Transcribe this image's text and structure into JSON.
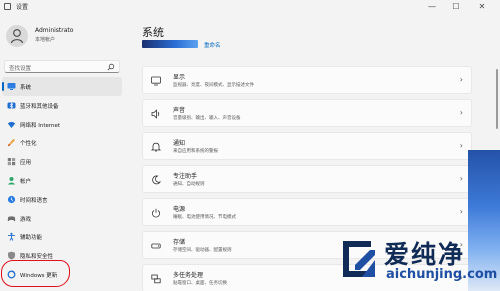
{
  "window": {
    "title": "设置",
    "minimize": "—",
    "maximize": "☐",
    "close": "✕"
  },
  "profile": {
    "name": "Administrato",
    "account_type": "本地帐户"
  },
  "search": {
    "placeholder": "查找设置"
  },
  "nav": {
    "items": [
      {
        "label": "系统",
        "icon": "monitor-icon"
      },
      {
        "label": "蓝牙和其他设备",
        "icon": "bluetooth-icon"
      },
      {
        "label": "网络和 Internet",
        "icon": "wifi-icon"
      },
      {
        "label": "个性化",
        "icon": "brush-icon"
      },
      {
        "label": "应用",
        "icon": "apps-icon"
      },
      {
        "label": "帐户",
        "icon": "person-icon"
      },
      {
        "label": "时间和语言",
        "icon": "globe-clock-icon"
      },
      {
        "label": "游戏",
        "icon": "gamepad-icon"
      },
      {
        "label": "辅助功能",
        "icon": "accessibility-icon"
      },
      {
        "label": "隐私和安全性",
        "icon": "shield-icon"
      },
      {
        "label": "Windows 更新",
        "icon": "windows-update-icon"
      }
    ],
    "active_index": 0
  },
  "main": {
    "title": "系统",
    "hero_link": "重命名",
    "cards": [
      {
        "title": "显示",
        "subtitle": "监视器、亮度、夜间模式、显示描述文件",
        "icon": "display-icon"
      },
      {
        "title": "声音",
        "subtitle": "音量级别、输出、输入、声音设备",
        "icon": "speaker-icon"
      },
      {
        "title": "通知",
        "subtitle": "来自应用和系统的警报",
        "icon": "bell-icon"
      },
      {
        "title": "专注助手",
        "subtitle": "通知、自动规则",
        "icon": "moon-icon"
      },
      {
        "title": "电源",
        "subtitle": "睡眠、电池使用情况、节电模式",
        "icon": "power-icon"
      },
      {
        "title": "存储",
        "subtitle": "存储空间、驱动器、配置规则",
        "icon": "storage-icon"
      },
      {
        "title": "多任务处理",
        "subtitle": "贴靠窗口、桌面、任务切换",
        "icon": "multitask-icon"
      }
    ],
    "chevron": "›"
  },
  "watermark": {
    "text_cn": "爱纯净",
    "text_url": "aichunjing.com"
  },
  "colors": {
    "accent": "#0067c0",
    "highlight_circle": "#e0101a",
    "background": "#f3f3f3",
    "card": "#fbfbfb"
  }
}
